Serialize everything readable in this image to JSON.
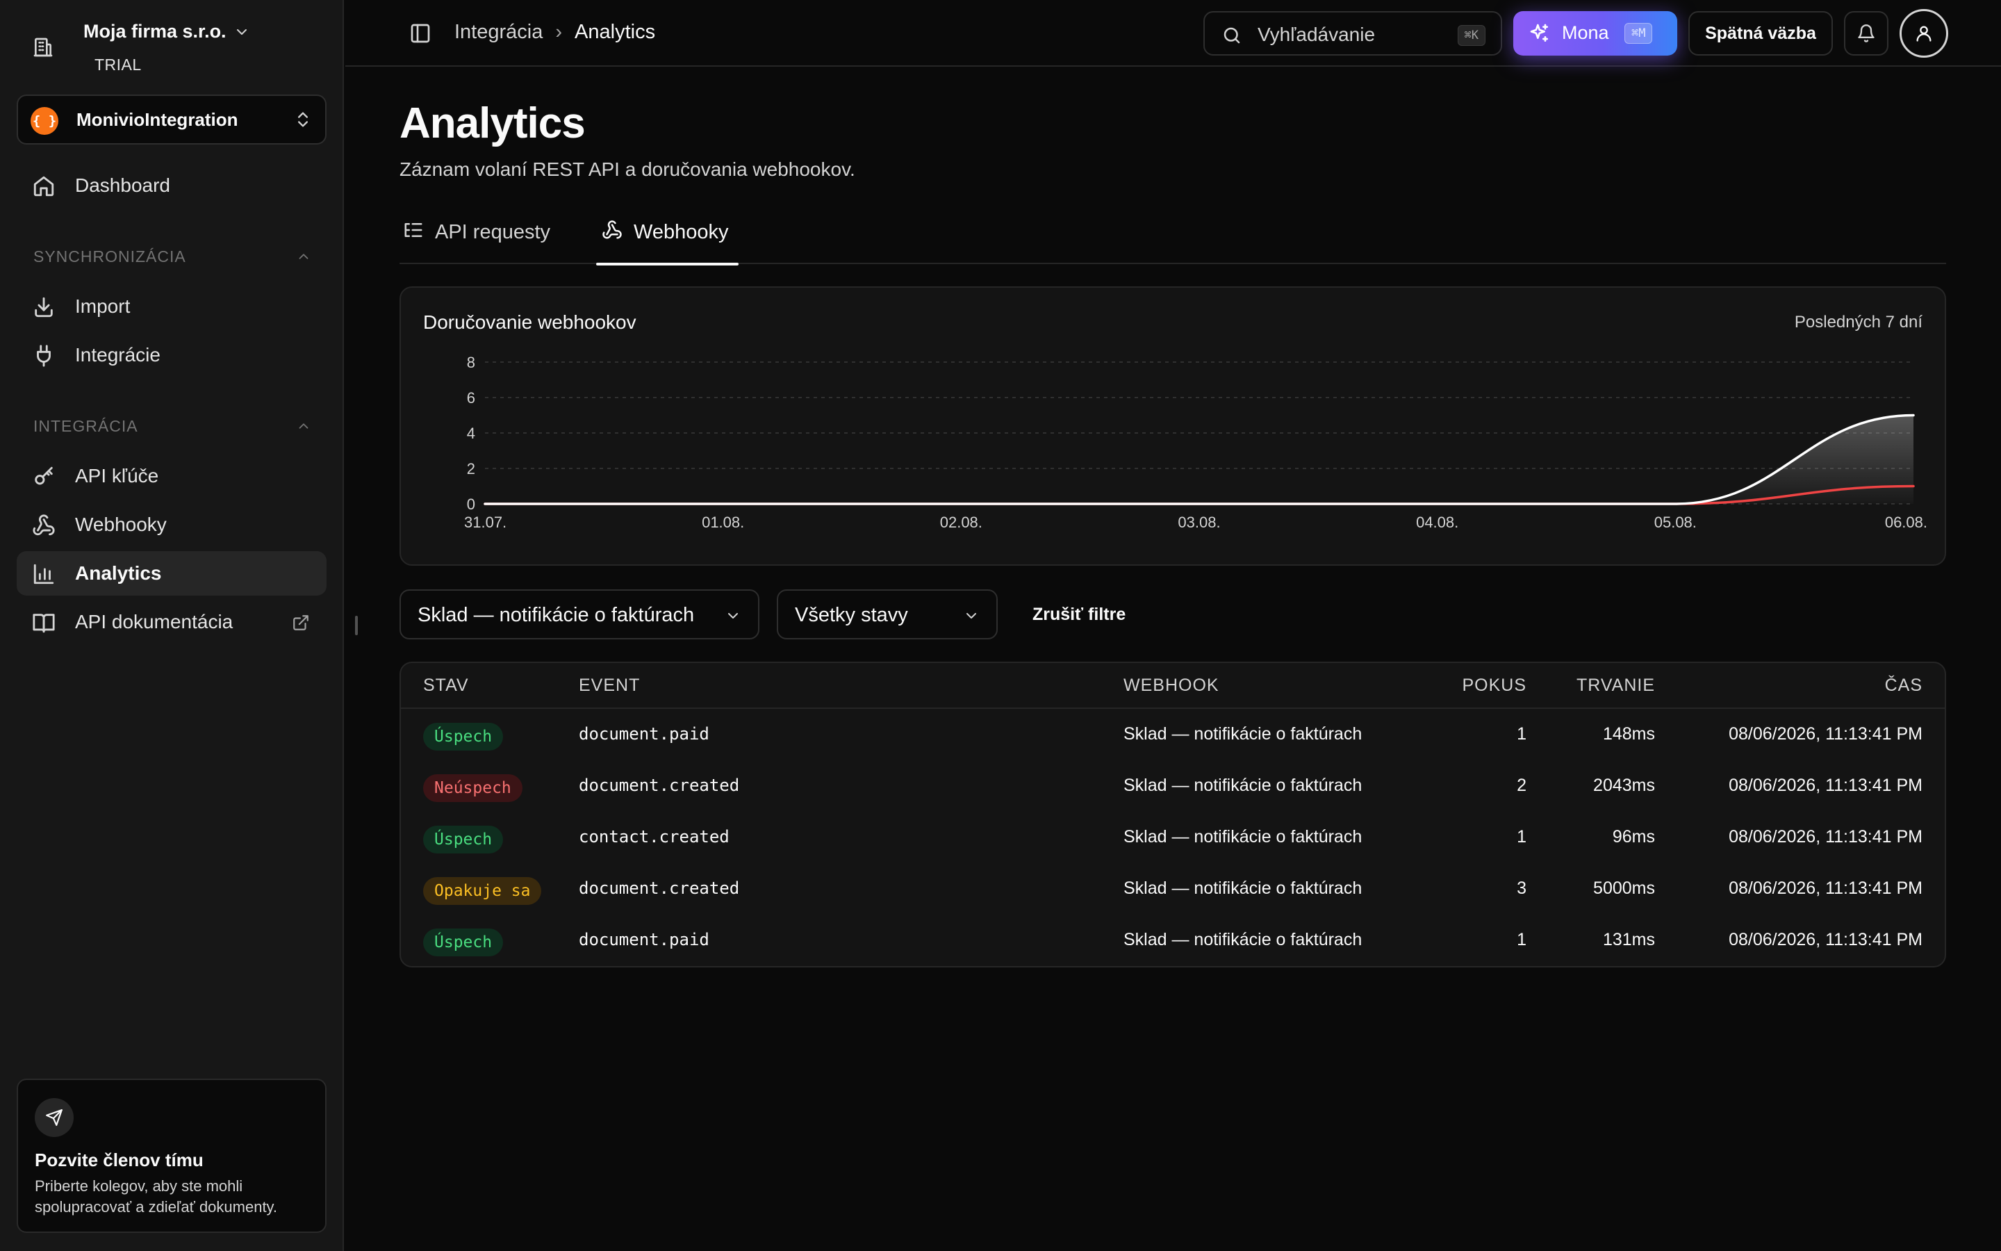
{
  "sidebar": {
    "company_name": "Moja firma s.r.o.",
    "plan": "TRIAL",
    "project": {
      "logo": "{ }",
      "name": "MonivioIntegration"
    },
    "dashboard": "Dashboard",
    "section_sync": "SYNCHRONIZÁCIA",
    "import": "Import",
    "integracie": "Integrácie",
    "section_integ": "INTEGRÁCIA",
    "api_keys": "API kľúče",
    "webhooks": "Webhooky",
    "analytics": "Analytics",
    "api_docs": "API dokumentácia",
    "invite": {
      "title": "Pozvite členov tímu",
      "desc": "Priberte kolegov, aby ste mohli spolupracovať a zdieľať dokumenty."
    },
    "icons": [
      "building-icon",
      "chevron-down-icon",
      "chevrons-up-down-icon",
      "home-icon",
      "download-icon",
      "plug-icon",
      "key-icon",
      "webhook-icon",
      "bar-chart-icon",
      "book-icon",
      "external-link-icon",
      "send-icon"
    ]
  },
  "header": {
    "breadcrumb_parent": "Integrácia",
    "breadcrumb_sep": "›",
    "breadcrumb_current": "Analytics",
    "search_placeholder": "Vyhľadávanie",
    "search_kbd": "⌘K",
    "mona_label": "Mona",
    "mona_kbd": "⌘M",
    "feedback": "Spätná väzba",
    "icons": [
      "sidebar-panel-icon",
      "search-icon",
      "sparkles-icon",
      "bell-icon",
      "user-icon"
    ]
  },
  "page": {
    "title": "Analytics",
    "subtitle": "Záznam volaní REST API a doručovania webhookov."
  },
  "tabs": [
    {
      "label": "API requesty",
      "icon": "list-tree-icon",
      "active": false
    },
    {
      "label": "Webhooky",
      "icon": "webhook-icon",
      "active": true
    }
  ],
  "chart_card": {
    "title": "Doručovanie webhookov",
    "range": "Posledných 7 dní"
  },
  "chart_data": {
    "type": "area",
    "title": "Doručovanie webhookov",
    "x": [
      "31.07.",
      "01.08.",
      "02.08.",
      "03.08.",
      "04.08.",
      "05.08.",
      "06.08."
    ],
    "ylim": [
      0,
      8
    ],
    "yticks": [
      0,
      2,
      4,
      6,
      8
    ],
    "grid": true,
    "series": [
      {
        "color": "#ffffff",
        "values": [
          0,
          0,
          0,
          0,
          0,
          0,
          5
        ]
      },
      {
        "color": "#ef4444",
        "values": [
          0,
          0,
          0,
          0,
          0,
          0,
          1
        ]
      }
    ]
  },
  "filters": {
    "webhook": "Sklad — notifikácie o faktúrach",
    "status": "Všetky stavy",
    "clear": "Zrušiť filtre"
  },
  "table": {
    "headers": {
      "stav": "STAV",
      "event": "EVENT",
      "webhook": "WEBHOOK",
      "pokus": "POKUS",
      "trvanie": "TRVANIE",
      "cas": "ČAS"
    },
    "status_colors": {
      "Úspech": {
        "bg": "#0f2e1f",
        "fg": "#4ade80"
      },
      "Neúspech": {
        "bg": "#3b1416",
        "fg": "#f87171"
      },
      "Opakuje sa": {
        "bg": "#3a2a0d",
        "fg": "#fbbf24"
      }
    },
    "rows": [
      {
        "status": "Úspech",
        "event": "document.paid",
        "webhook": "Sklad — notifikácie o faktúrach",
        "attempt": "1",
        "duration": "148ms",
        "time": "08/06/2026, 11:13:41 PM"
      },
      {
        "status": "Neúspech",
        "event": "document.created",
        "webhook": "Sklad — notifikácie o faktúrach",
        "attempt": "2",
        "duration": "2043ms",
        "time": "08/06/2026, 11:13:41 PM"
      },
      {
        "status": "Úspech",
        "event": "contact.created",
        "webhook": "Sklad — notifikácie o faktúrach",
        "attempt": "1",
        "duration": "96ms",
        "time": "08/06/2026, 11:13:41 PM"
      },
      {
        "status": "Opakuje sa",
        "event": "document.created",
        "webhook": "Sklad — notifikácie o faktúrach",
        "attempt": "3",
        "duration": "5000ms",
        "time": "08/06/2026, 11:13:41 PM"
      },
      {
        "status": "Úspech",
        "event": "document.paid",
        "webhook": "Sklad — notifikácie o faktúrach",
        "attempt": "1",
        "duration": "131ms",
        "time": "08/06/2026, 11:13:41 PM"
      }
    ]
  }
}
